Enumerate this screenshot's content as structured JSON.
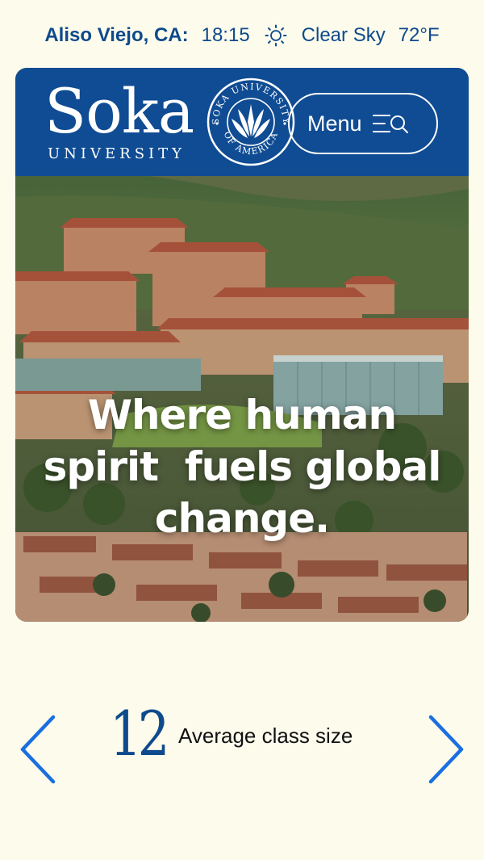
{
  "status": {
    "location": "Aliso Viejo, CA:",
    "time": "18:15",
    "weather_icon": "sun-icon",
    "condition": "Clear Sky",
    "temperature": "72°F"
  },
  "header": {
    "logo_word": "Soka",
    "logo_sub": "UNIVERSITY",
    "seal_text_top": "SOKA UNIVERSITY",
    "seal_text_bottom": "OF AMERICA",
    "menu_label": "Menu",
    "menu_icon": "menu-search-icon"
  },
  "hero": {
    "headline_line1": "Where human",
    "headline_line2": "spirit  fuels global",
    "headline_line3": "change."
  },
  "stat": {
    "value": "12",
    "label": "Average class size"
  },
  "colors": {
    "brand_blue": "#0f4c93",
    "background": "#fdfbec",
    "arrow_blue": "#1a6fe0"
  }
}
